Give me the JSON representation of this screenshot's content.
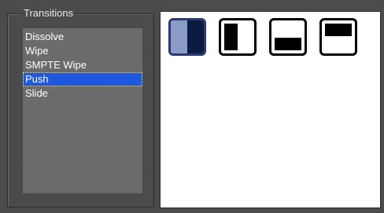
{
  "transitions": {
    "title": "Transitions",
    "items": [
      {
        "label": "Dissolve",
        "selected": false
      },
      {
        "label": "Wipe",
        "selected": false
      },
      {
        "label": "SMPTE Wipe",
        "selected": false
      },
      {
        "label": "Push",
        "selected": true
      },
      {
        "label": "Slide",
        "selected": false
      }
    ]
  },
  "variants": [
    {
      "icon": "push-split-horizontal-icon",
      "selected": true
    },
    {
      "icon": "push-left-icon",
      "selected": false
    },
    {
      "icon": "push-up-icon",
      "selected": false
    },
    {
      "icon": "push-down-icon",
      "selected": false
    }
  ],
  "colors": {
    "background": "#4b4b4b",
    "list_background": "#6e6e6e",
    "selection": "#1f58e0",
    "selected_thumb_fill": "#8a9cc8",
    "selected_thumb_dark": "#0b1a3f"
  }
}
